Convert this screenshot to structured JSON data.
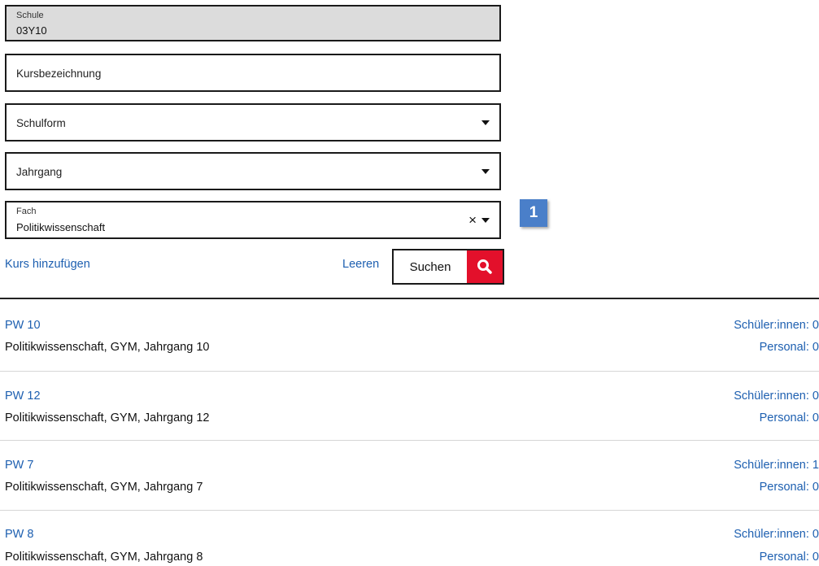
{
  "form": {
    "schule": {
      "label": "Schule",
      "value": "03Y10"
    },
    "kursbezeichnung": {
      "placeholder": "Kursbezeichnung"
    },
    "schulform": {
      "placeholder": "Schulform"
    },
    "jahrgang": {
      "placeholder": "Jahrgang"
    },
    "fach": {
      "label": "Fach",
      "value": "Politikwissenschaft",
      "clear_icon": "×"
    },
    "badge": "1"
  },
  "actions": {
    "add_course": "Kurs hinzufügen",
    "clear": "Leeren",
    "search": "Suchen"
  },
  "colors": {
    "link": "#1d5fb0",
    "search_accent": "#e3102b",
    "badge": "#4a7fc9"
  },
  "courses": [
    {
      "title": "PW 10",
      "description": "Politikwissenschaft, GYM, Jahrgang 10",
      "students": "Schüler:innen: 0",
      "staff": "Personal: 0"
    },
    {
      "title": "PW 12",
      "description": "Politikwissenschaft, GYM, Jahrgang 12",
      "students": "Schüler:innen: 0",
      "staff": "Personal: 0"
    },
    {
      "title": "PW 7",
      "description": "Politikwissenschaft, GYM, Jahrgang 7",
      "students": "Schüler:innen: 1",
      "staff": "Personal: 0"
    },
    {
      "title": "PW 8",
      "description": "Politikwissenschaft, GYM, Jahrgang 8",
      "students": "Schüler:innen: 0",
      "staff": "Personal: 0"
    }
  ]
}
